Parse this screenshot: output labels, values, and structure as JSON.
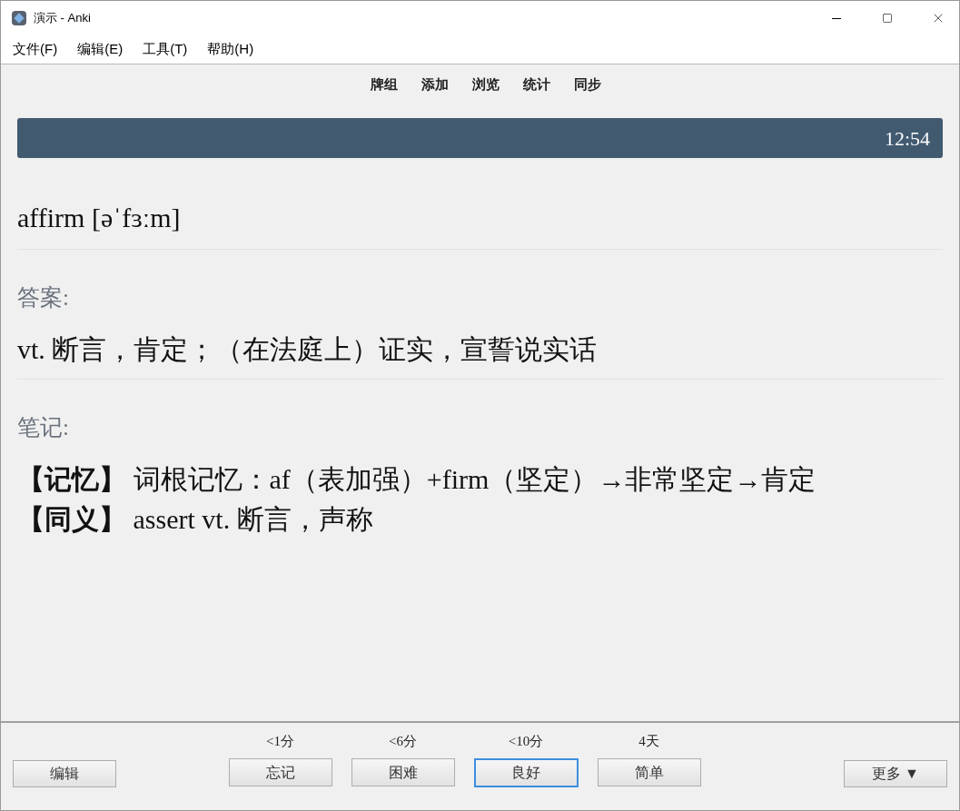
{
  "window": {
    "title": "演示 - Anki"
  },
  "menu": [
    "文件(F)",
    "编辑(E)",
    "工具(T)",
    "帮助(H)"
  ],
  "toolbar": [
    "牌组",
    "添加",
    "浏览",
    "统计",
    "同步"
  ],
  "timer": "12:54",
  "card": {
    "question": "affirm [əˈfɜːm]",
    "answer_label": "答案:",
    "answer": "vt. 断言，肯定；（在法庭上）证实，宣誓说实话",
    "notes_label": "笔记:",
    "notes": [
      "**【记忆】** 词根记忆：af（表加强）+firm（坚定）→非常坚定→肯定",
      "**【同义】** assert vt. 断言，声称"
    ]
  },
  "edit_button": "编辑",
  "answers": [
    {
      "interval": "<1分",
      "label": "忘记",
      "focused": false
    },
    {
      "interval": "<6分",
      "label": "困难",
      "focused": false
    },
    {
      "interval": "<10分",
      "label": "良好",
      "focused": true
    },
    {
      "interval": "4天",
      "label": "简单",
      "focused": false
    }
  ],
  "more_button": "更多 ▼"
}
